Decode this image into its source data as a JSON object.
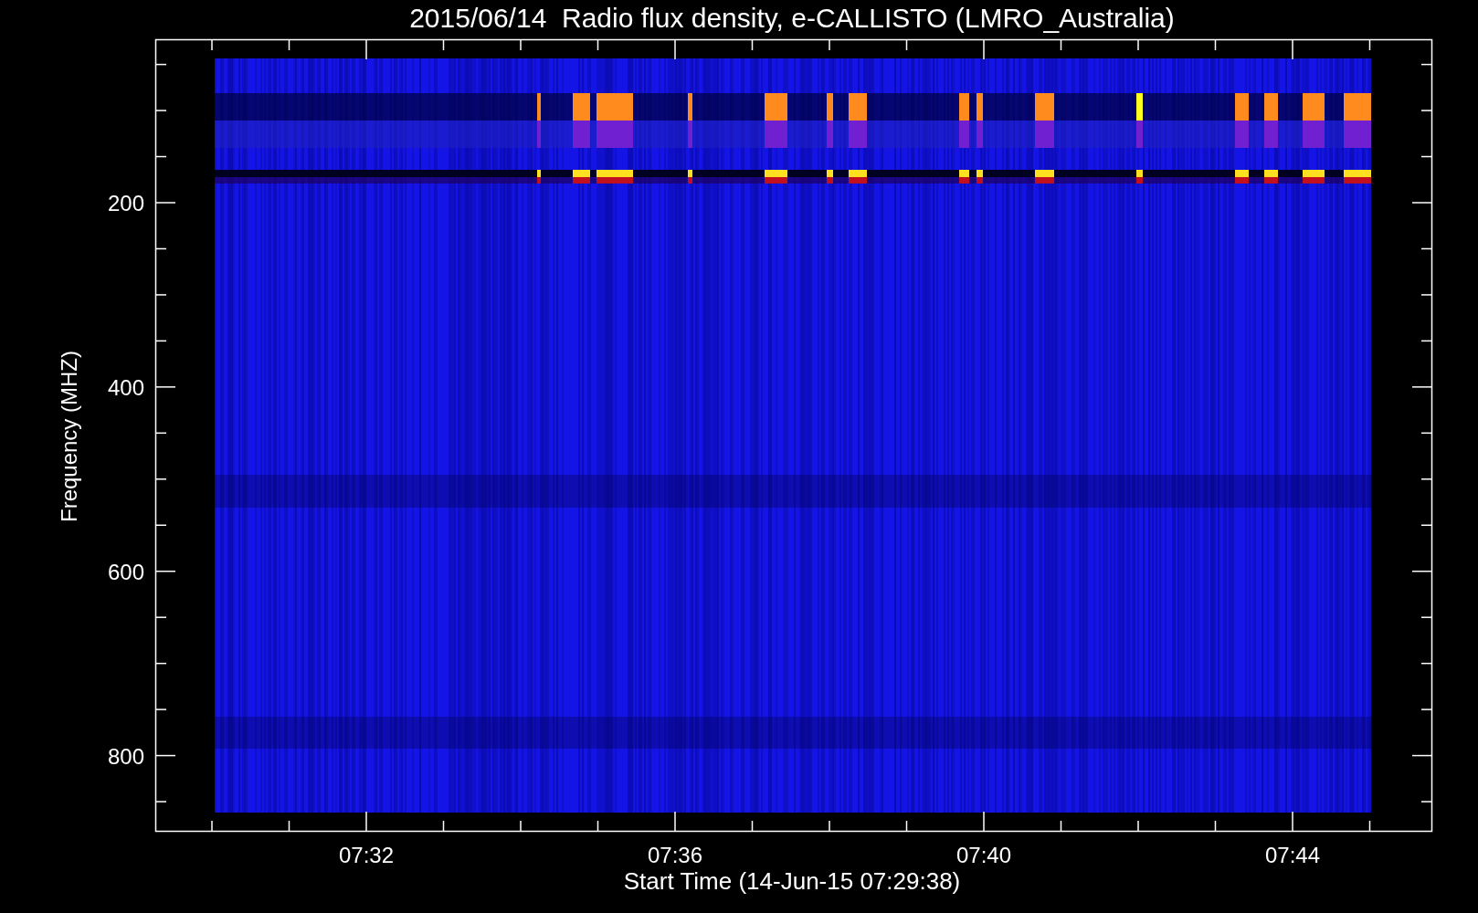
{
  "title": "2015/06/14  Radio flux density, e-CALLISTO (LMRO_Australia)",
  "y_axis": {
    "label": "Frequency (MHZ)",
    "ticks": [
      "200",
      "400",
      "600",
      "800"
    ]
  },
  "x_axis": {
    "label": "Start Time (14-Jun-15 07:29:38)",
    "ticks": [
      "07:32",
      "07:36",
      "07:40",
      "07:44"
    ]
  }
}
